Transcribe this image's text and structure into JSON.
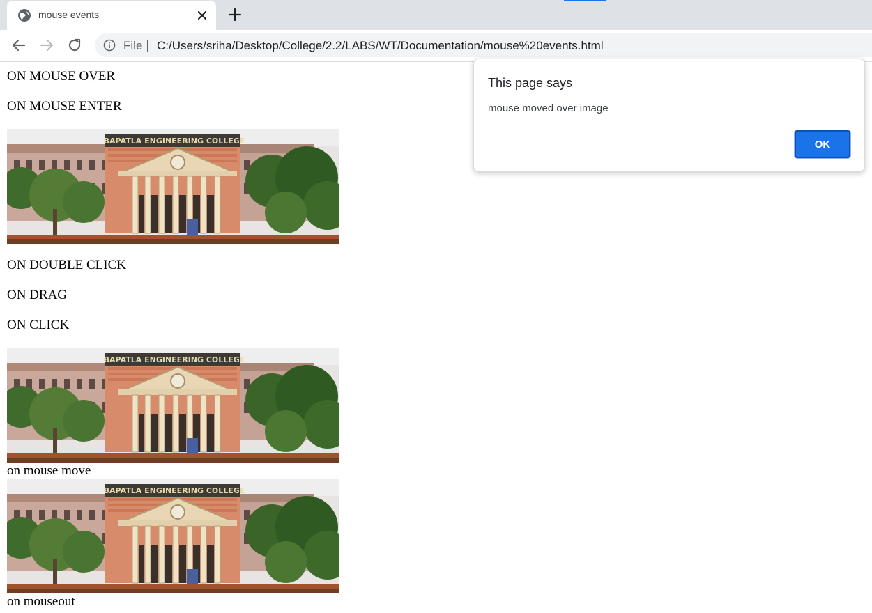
{
  "browser": {
    "tab": {
      "title": "mouse events",
      "icon": "globe-icon",
      "close_icon": "close-icon"
    },
    "new_tab_icon": "plus-icon",
    "toolbar": {
      "back_icon": "back-arrow-icon",
      "forward_icon": "forward-arrow-icon",
      "reload_icon": "reload-icon",
      "info_icon": "info-icon",
      "scheme_label": "File",
      "url": "C:/Users/sriha/Desktop/College/2.2/LABS/WT/Documentation/mouse%20events.html"
    },
    "accent_color": "#1a73e8"
  },
  "page": {
    "headings": {
      "mouse_over": "ON MOUSE OVER",
      "mouse_enter": "ON MOUSE ENTER",
      "double_click": "ON DOUBLE CLICK",
      "drag": "ON DRAG",
      "click": "ON CLICK"
    },
    "captions": {
      "mouse_move": "on mouse move",
      "mouseout": "on mouseout"
    },
    "image_sign_text": "BAPATLA ENGINEERING COLLEGE"
  },
  "dialog": {
    "title": "This page says",
    "message": "mouse moved over image",
    "ok_label": "OK"
  }
}
